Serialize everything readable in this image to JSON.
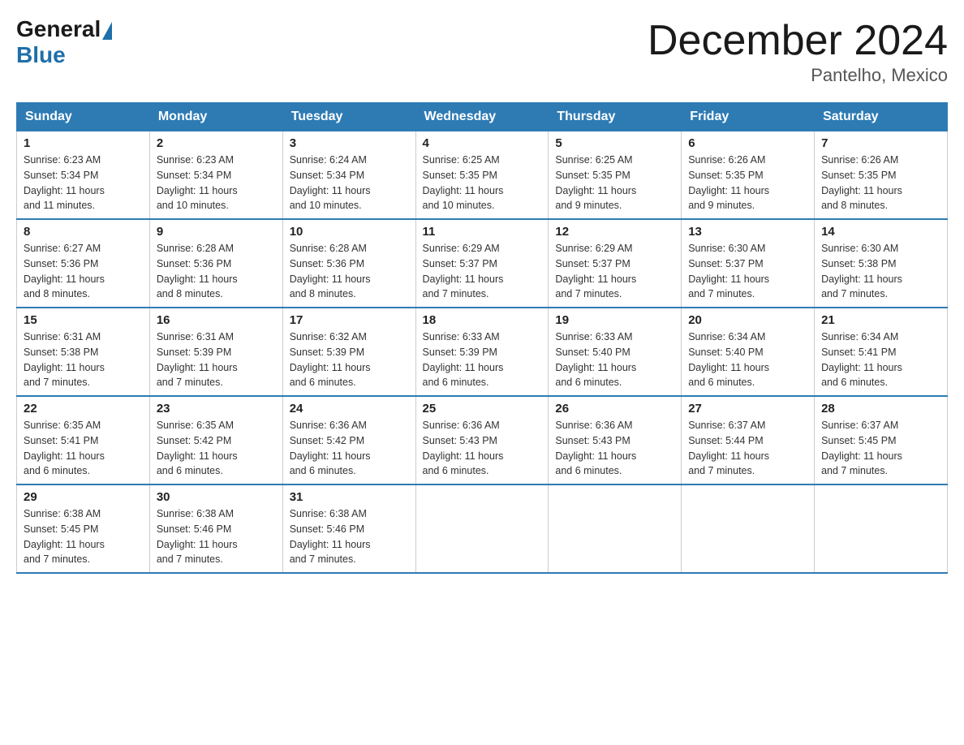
{
  "logo": {
    "general": "General",
    "blue": "Blue"
  },
  "title": "December 2024",
  "subtitle": "Pantelho, Mexico",
  "days_of_week": [
    "Sunday",
    "Monday",
    "Tuesday",
    "Wednesday",
    "Thursday",
    "Friday",
    "Saturday"
  ],
  "weeks": [
    [
      {
        "day": "1",
        "sunrise": "6:23 AM",
        "sunset": "5:34 PM",
        "daylight": "11 hours and 11 minutes."
      },
      {
        "day": "2",
        "sunrise": "6:23 AM",
        "sunset": "5:34 PM",
        "daylight": "11 hours and 10 minutes."
      },
      {
        "day": "3",
        "sunrise": "6:24 AM",
        "sunset": "5:34 PM",
        "daylight": "11 hours and 10 minutes."
      },
      {
        "day": "4",
        "sunrise": "6:25 AM",
        "sunset": "5:35 PM",
        "daylight": "11 hours and 10 minutes."
      },
      {
        "day": "5",
        "sunrise": "6:25 AM",
        "sunset": "5:35 PM",
        "daylight": "11 hours and 9 minutes."
      },
      {
        "day": "6",
        "sunrise": "6:26 AM",
        "sunset": "5:35 PM",
        "daylight": "11 hours and 9 minutes."
      },
      {
        "day": "7",
        "sunrise": "6:26 AM",
        "sunset": "5:35 PM",
        "daylight": "11 hours and 8 minutes."
      }
    ],
    [
      {
        "day": "8",
        "sunrise": "6:27 AM",
        "sunset": "5:36 PM",
        "daylight": "11 hours and 8 minutes."
      },
      {
        "day": "9",
        "sunrise": "6:28 AM",
        "sunset": "5:36 PM",
        "daylight": "11 hours and 8 minutes."
      },
      {
        "day": "10",
        "sunrise": "6:28 AM",
        "sunset": "5:36 PM",
        "daylight": "11 hours and 8 minutes."
      },
      {
        "day": "11",
        "sunrise": "6:29 AM",
        "sunset": "5:37 PM",
        "daylight": "11 hours and 7 minutes."
      },
      {
        "day": "12",
        "sunrise": "6:29 AM",
        "sunset": "5:37 PM",
        "daylight": "11 hours and 7 minutes."
      },
      {
        "day": "13",
        "sunrise": "6:30 AM",
        "sunset": "5:37 PM",
        "daylight": "11 hours and 7 minutes."
      },
      {
        "day": "14",
        "sunrise": "6:30 AM",
        "sunset": "5:38 PM",
        "daylight": "11 hours and 7 minutes."
      }
    ],
    [
      {
        "day": "15",
        "sunrise": "6:31 AM",
        "sunset": "5:38 PM",
        "daylight": "11 hours and 7 minutes."
      },
      {
        "day": "16",
        "sunrise": "6:31 AM",
        "sunset": "5:39 PM",
        "daylight": "11 hours and 7 minutes."
      },
      {
        "day": "17",
        "sunrise": "6:32 AM",
        "sunset": "5:39 PM",
        "daylight": "11 hours and 6 minutes."
      },
      {
        "day": "18",
        "sunrise": "6:33 AM",
        "sunset": "5:39 PM",
        "daylight": "11 hours and 6 minutes."
      },
      {
        "day": "19",
        "sunrise": "6:33 AM",
        "sunset": "5:40 PM",
        "daylight": "11 hours and 6 minutes."
      },
      {
        "day": "20",
        "sunrise": "6:34 AM",
        "sunset": "5:40 PM",
        "daylight": "11 hours and 6 minutes."
      },
      {
        "day": "21",
        "sunrise": "6:34 AM",
        "sunset": "5:41 PM",
        "daylight": "11 hours and 6 minutes."
      }
    ],
    [
      {
        "day": "22",
        "sunrise": "6:35 AM",
        "sunset": "5:41 PM",
        "daylight": "11 hours and 6 minutes."
      },
      {
        "day": "23",
        "sunrise": "6:35 AM",
        "sunset": "5:42 PM",
        "daylight": "11 hours and 6 minutes."
      },
      {
        "day": "24",
        "sunrise": "6:36 AM",
        "sunset": "5:42 PM",
        "daylight": "11 hours and 6 minutes."
      },
      {
        "day": "25",
        "sunrise": "6:36 AM",
        "sunset": "5:43 PM",
        "daylight": "11 hours and 6 minutes."
      },
      {
        "day": "26",
        "sunrise": "6:36 AM",
        "sunset": "5:43 PM",
        "daylight": "11 hours and 6 minutes."
      },
      {
        "day": "27",
        "sunrise": "6:37 AM",
        "sunset": "5:44 PM",
        "daylight": "11 hours and 7 minutes."
      },
      {
        "day": "28",
        "sunrise": "6:37 AM",
        "sunset": "5:45 PM",
        "daylight": "11 hours and 7 minutes."
      }
    ],
    [
      {
        "day": "29",
        "sunrise": "6:38 AM",
        "sunset": "5:45 PM",
        "daylight": "11 hours and 7 minutes."
      },
      {
        "day": "30",
        "sunrise": "6:38 AM",
        "sunset": "5:46 PM",
        "daylight": "11 hours and 7 minutes."
      },
      {
        "day": "31",
        "sunrise": "6:38 AM",
        "sunset": "5:46 PM",
        "daylight": "11 hours and 7 minutes."
      },
      null,
      null,
      null,
      null
    ]
  ],
  "labels": {
    "sunrise": "Sunrise:",
    "sunset": "Sunset:",
    "daylight": "Daylight:"
  }
}
